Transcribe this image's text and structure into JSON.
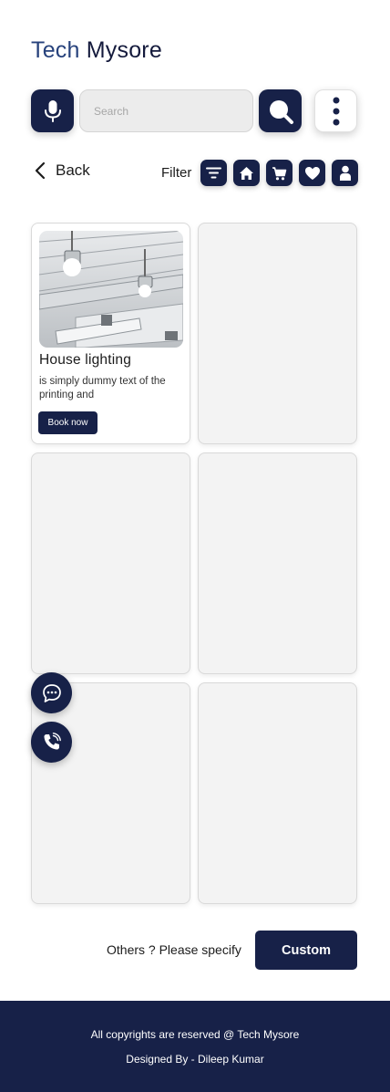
{
  "brand": {
    "part1": "Tech",
    "part2": "Mysore"
  },
  "search": {
    "placeholder": "Search"
  },
  "nav": {
    "back_label": "Back",
    "filter_label": "Filter"
  },
  "filter_icons": [
    "filter-lines-icon",
    "home-icon",
    "cart-icon",
    "heart-icon",
    "person-icon"
  ],
  "cards": [
    {
      "title": "House lighting",
      "description": "is simply dummy text of the printing and",
      "button": "Book now"
    },
    {},
    {},
    {},
    {},
    {}
  ],
  "floating": [
    "chat-icon",
    "phone-call-icon"
  ],
  "custom": {
    "prompt": "Others ? Please specify",
    "button": "Custom"
  },
  "footer": {
    "copyright": "All copyrights are reserved @ Tech Mysore",
    "designer": "Designed By - Dileep Kumar"
  },
  "colors": {
    "navy": "#172148",
    "brand_blue": "#27427c",
    "card_bg": "#f3f3f3"
  }
}
